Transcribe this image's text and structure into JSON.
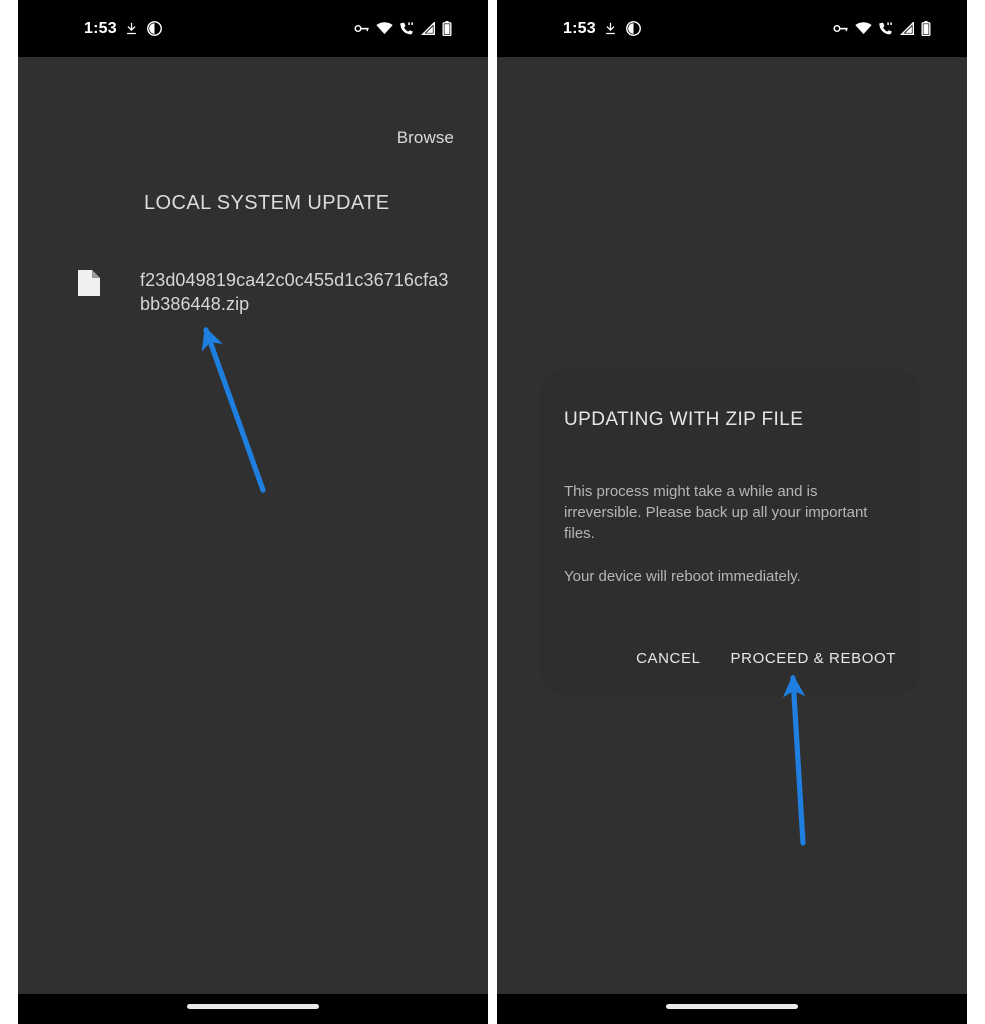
{
  "meta": {
    "accent_blue": "#1f7fe0",
    "panel_bg": "#303030",
    "statusbar_bg": "#000000",
    "dialog_bg": "#2e2e2e"
  },
  "statusbar": {
    "clock": "1:53",
    "left_icons": [
      "download-arrow-icon",
      "dark-theme-circle-icon"
    ],
    "right_icons": [
      "vpn-key-icon",
      "wifi-icon",
      "phone-call-icon",
      "signal-cellular-icon",
      "battery-icon"
    ]
  },
  "left_panel": {
    "browse_label": "Browse",
    "screen_title": "LOCAL SYSTEM UPDATE",
    "file": {
      "icon": "document-file-icon",
      "name": "f23d049819ca42c0c455d1c36716cfa3bb386448.zip"
    },
    "annotation": {
      "type": "arrow",
      "color": "#1f7fe0",
      "points_to": "file-name"
    }
  },
  "right_panel": {
    "dialog": {
      "title": "UPDATING WITH ZIP FILE",
      "paragraphs": [
        "This process might take a while and is irreversible. Please back up all your important files.",
        "Your device will reboot immediately."
      ],
      "cancel_label": "CANCEL",
      "proceed_label": "PROCEED & REBOOT"
    },
    "annotation": {
      "type": "arrow",
      "color": "#1f7fe0",
      "points_to": "proceed-reboot-button"
    }
  },
  "navbar": {
    "gesture_pill": "home-gesture-pill"
  }
}
